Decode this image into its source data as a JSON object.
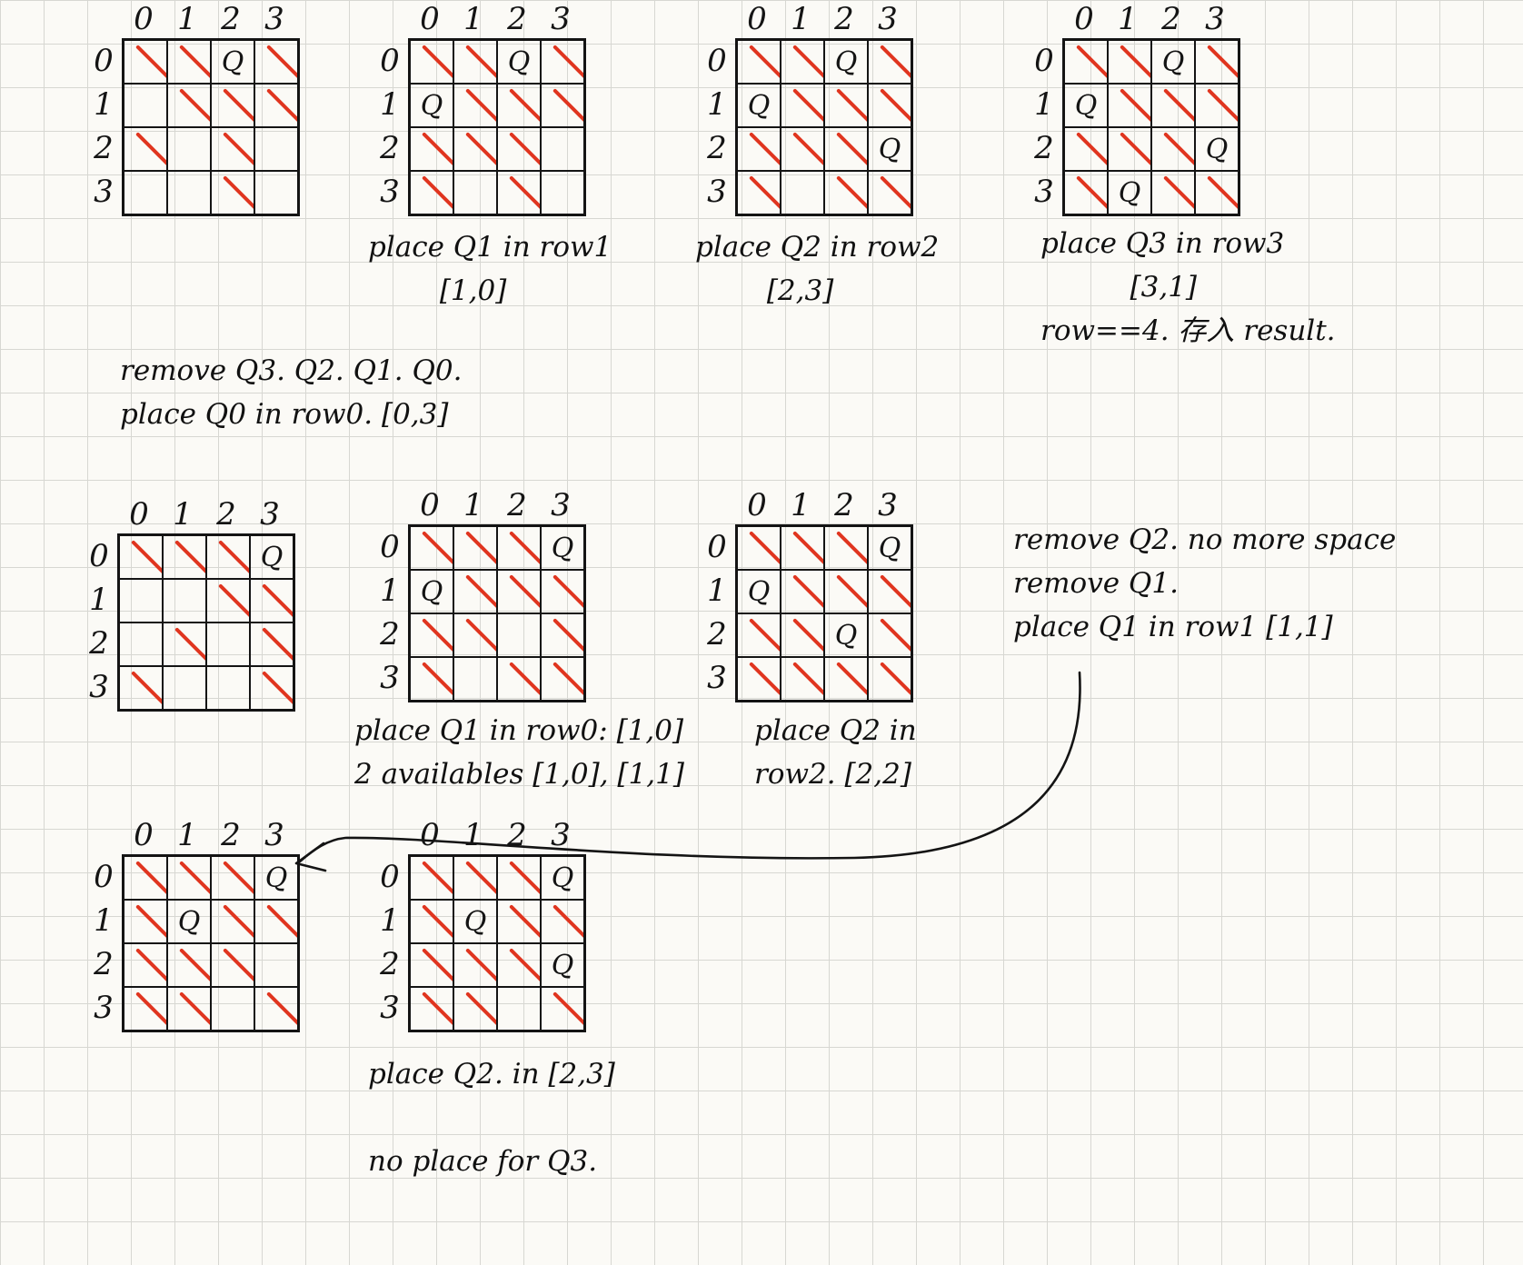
{
  "axis_labels": [
    "0",
    "1",
    "2",
    "3"
  ],
  "boards": [
    {
      "id": "board-1",
      "queens": [
        [
          0,
          2
        ]
      ],
      "slashes": [
        [
          0,
          0
        ],
        [
          0,
          1
        ],
        [
          0,
          3
        ],
        [
          1,
          1
        ],
        [
          1,
          2
        ],
        [
          1,
          3
        ],
        [
          2,
          0
        ],
        [
          2,
          2
        ],
        [
          3,
          2
        ]
      ]
    },
    {
      "id": "board-2",
      "queens": [
        [
          0,
          2
        ],
        [
          1,
          0
        ]
      ],
      "slashes": [
        [
          0,
          0
        ],
        [
          0,
          1
        ],
        [
          0,
          3
        ],
        [
          1,
          1
        ],
        [
          1,
          2
        ],
        [
          1,
          3
        ],
        [
          2,
          0
        ],
        [
          2,
          1
        ],
        [
          2,
          2
        ],
        [
          3,
          0
        ],
        [
          3,
          2
        ]
      ]
    },
    {
      "id": "board-3",
      "queens": [
        [
          0,
          2
        ],
        [
          1,
          0
        ],
        [
          2,
          3
        ]
      ],
      "slashes": [
        [
          0,
          0
        ],
        [
          0,
          1
        ],
        [
          0,
          3
        ],
        [
          1,
          1
        ],
        [
          1,
          2
        ],
        [
          1,
          3
        ],
        [
          2,
          0
        ],
        [
          2,
          1
        ],
        [
          2,
          2
        ],
        [
          3,
          0
        ],
        [
          3,
          2
        ],
        [
          3,
          3
        ]
      ]
    },
    {
      "id": "board-4",
      "queens": [
        [
          0,
          2
        ],
        [
          1,
          0
        ],
        [
          2,
          3
        ],
        [
          3,
          1
        ]
      ],
      "slashes": [
        [
          0,
          0
        ],
        [
          0,
          1
        ],
        [
          0,
          3
        ],
        [
          1,
          1
        ],
        [
          1,
          2
        ],
        [
          1,
          3
        ],
        [
          2,
          0
        ],
        [
          2,
          1
        ],
        [
          2,
          2
        ],
        [
          3,
          0
        ],
        [
          3,
          2
        ],
        [
          3,
          3
        ]
      ]
    },
    {
      "id": "board-5",
      "queens": [
        [
          0,
          3
        ]
      ],
      "slashes": [
        [
          0,
          0
        ],
        [
          0,
          1
        ],
        [
          0,
          2
        ],
        [
          1,
          2
        ],
        [
          1,
          3
        ],
        [
          2,
          1
        ],
        [
          2,
          3
        ],
        [
          3,
          0
        ],
        [
          3,
          3
        ]
      ]
    },
    {
      "id": "board-6",
      "queens": [
        [
          0,
          3
        ],
        [
          1,
          0
        ]
      ],
      "slashes": [
        [
          0,
          0
        ],
        [
          0,
          1
        ],
        [
          0,
          2
        ],
        [
          1,
          1
        ],
        [
          1,
          2
        ],
        [
          1,
          3
        ],
        [
          2,
          0
        ],
        [
          2,
          1
        ],
        [
          2,
          3
        ],
        [
          3,
          0
        ],
        [
          3,
          2
        ],
        [
          3,
          3
        ]
      ]
    },
    {
      "id": "board-7",
      "queens": [
        [
          0,
          3
        ],
        [
          1,
          0
        ],
        [
          2,
          2
        ]
      ],
      "slashes": [
        [
          0,
          0
        ],
        [
          0,
          1
        ],
        [
          0,
          2
        ],
        [
          1,
          1
        ],
        [
          1,
          2
        ],
        [
          1,
          3
        ],
        [
          2,
          0
        ],
        [
          2,
          1
        ],
        [
          2,
          3
        ],
        [
          3,
          0
        ],
        [
          3,
          1
        ],
        [
          3,
          2
        ],
        [
          3,
          3
        ]
      ]
    },
    {
      "id": "board-8",
      "queens": [
        [
          0,
          3
        ],
        [
          1,
          1
        ]
      ],
      "slashes": [
        [
          0,
          0
        ],
        [
          0,
          1
        ],
        [
          0,
          2
        ],
        [
          1,
          0
        ],
        [
          1,
          2
        ],
        [
          1,
          3
        ],
        [
          2,
          0
        ],
        [
          2,
          1
        ],
        [
          2,
          2
        ],
        [
          3,
          0
        ],
        [
          3,
          1
        ],
        [
          3,
          3
        ]
      ]
    },
    {
      "id": "board-9",
      "queens": [
        [
          0,
          3
        ],
        [
          1,
          1
        ],
        [
          2,
          3
        ]
      ],
      "slashes": [
        [
          0,
          0
        ],
        [
          0,
          1
        ],
        [
          0,
          2
        ],
        [
          1,
          0
        ],
        [
          1,
          2
        ],
        [
          1,
          3
        ],
        [
          2,
          0
        ],
        [
          2,
          1
        ],
        [
          2,
          2
        ],
        [
          3,
          0
        ],
        [
          3,
          1
        ],
        [
          3,
          3
        ]
      ]
    }
  ],
  "notes": {
    "n1": "place Q1 in row1\n        [1,0]",
    "n2": "place Q2 in row2\n        [2,3]",
    "n3": "place Q3 in row3\n          [3,1]\nrow==4. 存入 result.",
    "n4": "remove Q3. Q2. Q1. Q0.\nplace Q0 in row0. [0,3]",
    "n5": "place Q1 in row0: [1,0]\n2 availables [1,0], [1,1]",
    "n6": "place Q2 in\nrow2. [2,2]",
    "n7": "remove Q2. no more space\nremove Q1.\nplace Q1 in row1 [1,1]",
    "n8": "place Q2. in [2,3]\n\nno place for Q3."
  },
  "queen_symbol": "Q",
  "colors": {
    "ink": "#141414",
    "strike": "#e0351f",
    "paper": "#fbfaf6",
    "grid": "#d7d7d2"
  }
}
